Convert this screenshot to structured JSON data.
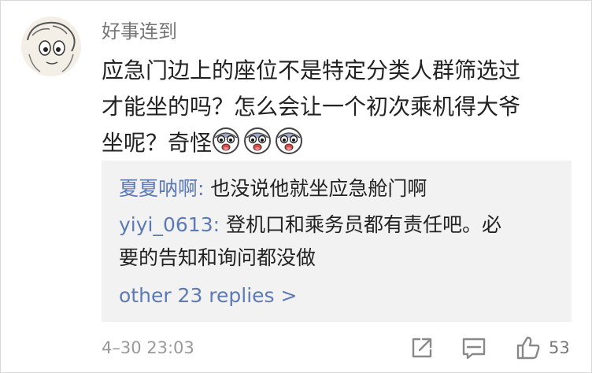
{
  "comment": {
    "username": "好事连到",
    "text_line1": "应急门边上的座位不是特定分类人群筛选过",
    "text_line2": "才能坐的吗？怎么会让一个初次乘机得大爷",
    "text_line3": "坐呢？奇怪",
    "emoji_count": 3,
    "timestamp": "4–30 23:03",
    "like_count": "53"
  },
  "replies": [
    {
      "name": "夏夏呐啊",
      "separator": ": ",
      "text": "也没说他就坐应急舱门啊"
    },
    {
      "name": "yiyi_0613",
      "separator": ": ",
      "text_line1": "登机口和乘务员都有责任吧。必",
      "text_line2": "要的告知和询问都没做"
    }
  ],
  "more_replies_label": "other 23 replies >",
  "icons": [
    "share-icon",
    "comment-icon",
    "like-icon"
  ],
  "colors": {
    "link_blue": "#5c7ab5",
    "reply_bg": "#f2f2f2",
    "meta_gray": "#999999"
  }
}
